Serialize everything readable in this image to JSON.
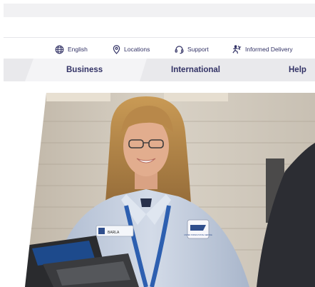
{
  "utility": {
    "language": "English",
    "locations": "Locations",
    "support": "Support",
    "informed_delivery": "Informed Delivery"
  },
  "nav": {
    "tabs": [
      {
        "label": "Business"
      },
      {
        "label": "International"
      },
      {
        "label": "Help"
      }
    ]
  },
  "hero": {
    "badge_text": "BARLA",
    "patch_text": "UNITED STATES POSTAL SERVICE"
  },
  "icons": {
    "language": "globe-icon",
    "locations": "location-pin-icon",
    "support": "headset-icon",
    "informed_delivery": "informed-delivery-icon"
  },
  "colors": {
    "brand_navy": "#333366",
    "nav_bg": "#e9e9ec",
    "topbar_bg": "#f1f1f3"
  }
}
